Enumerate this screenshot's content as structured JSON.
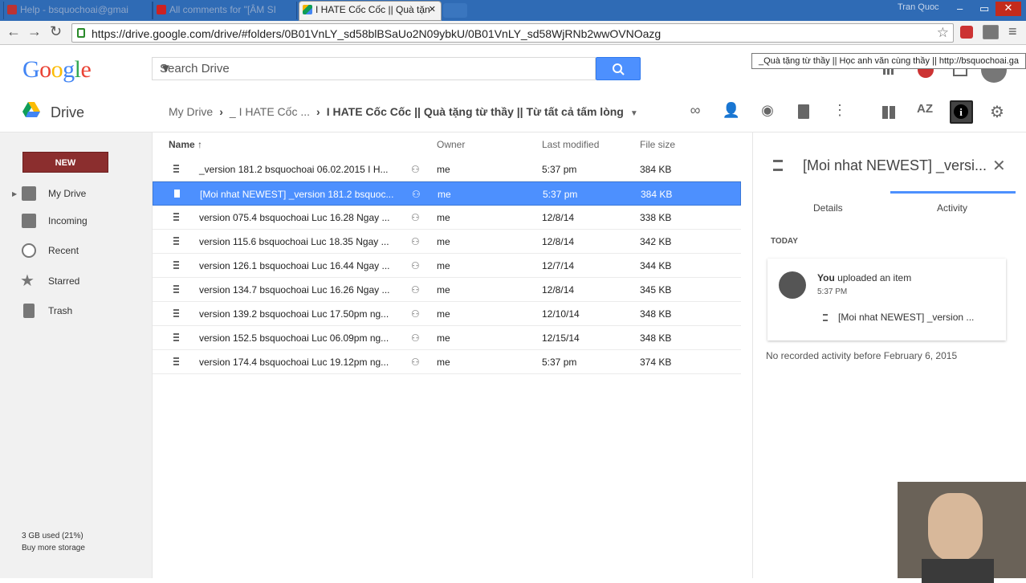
{
  "browser": {
    "tabs": [
      {
        "label": "Help - bsquochoai@gmai",
        "active": false
      },
      {
        "label": "All comments for \"[ÂM SI",
        "active": false
      },
      {
        "label": "I HATE Cốc Cốc || Quà tặn",
        "active": true
      }
    ],
    "window_user": "Tran Quoc",
    "url": "https://drive.google.com/drive/#folders/0B01VnLY_sd58blBSaUo2N09ybkU/0B01VnLY_sd58WjRNb2wwOVNOazg",
    "tooltip": "_Quà tặng từ thầy || Học anh văn cùng thầy || http://bsquochoai.ga"
  },
  "header": {
    "logo": "Google",
    "search_placeholder": "Search Drive"
  },
  "subheader": {
    "app_title": "Drive",
    "breadcrumb": [
      "My Drive",
      "_ I HATE Cốc ...",
      "I HATE Cốc Cốc || Quà tặng từ thầy || Từ tất cả tấm lòng"
    ]
  },
  "sidebar": {
    "new_label": "NEW",
    "items": [
      {
        "label": "My Drive",
        "icon": "my-drive-icon"
      },
      {
        "label": "Incoming",
        "icon": "incoming-icon"
      },
      {
        "label": "Recent",
        "icon": "clock-icon"
      },
      {
        "label": "Starred",
        "icon": "star-icon"
      },
      {
        "label": "Trash",
        "icon": "trash-icon"
      }
    ],
    "storage_used": "3 GB used (21%)",
    "buy_storage": "Buy more storage"
  },
  "file_list": {
    "columns": {
      "name": "Name ↑",
      "owner": "Owner",
      "modified": "Last modified",
      "size": "File size"
    },
    "rows": [
      {
        "name": "_version 181.2 bsquochoai 06.02.2015 I H...",
        "owner": "me",
        "modified": "5:37 pm",
        "size": "384 KB",
        "selected": false
      },
      {
        "name": "[Moi nhat NEWEST] _version 181.2 bsquoc...",
        "owner": "me",
        "modified": "5:37 pm",
        "size": "384 KB",
        "selected": true
      },
      {
        "name": "version 075.4 bsquochoai Luc 16.28 Ngay ...",
        "owner": "me",
        "modified": "12/8/14",
        "size": "338 KB",
        "selected": false
      },
      {
        "name": "version 115.6 bsquochoai Luc 18.35 Ngay ...",
        "owner": "me",
        "modified": "12/8/14",
        "size": "342 KB",
        "selected": false
      },
      {
        "name": "version 126.1 bsquochoai Luc 16.44 Ngay ...",
        "owner": "me",
        "modified": "12/7/14",
        "size": "344 KB",
        "selected": false
      },
      {
        "name": "version 134.7 bsquochoai Luc 16.26 Ngay ...",
        "owner": "me",
        "modified": "12/8/14",
        "size": "345 KB",
        "selected": false
      },
      {
        "name": "version 139.2 bsquochoai Luc 17.50pm ng...",
        "owner": "me",
        "modified": "12/10/14",
        "size": "348 KB",
        "selected": false
      },
      {
        "name": "version 152.5 bsquochoai Luc 06.09pm ng...",
        "owner": "me",
        "modified": "12/15/14",
        "size": "348 KB",
        "selected": false
      },
      {
        "name": "version 174.4 bsquochoai Luc 19.12pm ng...",
        "owner": "me",
        "modified": "5:37 pm",
        "size": "374 KB",
        "selected": false
      }
    ]
  },
  "details_panel": {
    "title": "[Moi nhat NEWEST] _versi...",
    "tabs": [
      "Details",
      "Activity"
    ],
    "active_tab": "Activity",
    "section": "TODAY",
    "activity": {
      "actor": "You",
      "action": "uploaded an item",
      "time": "5:37 PM",
      "file": "[Moi nhat NEWEST] _version ..."
    },
    "no_record": "No recorded activity before February 6, 2015"
  },
  "colors": {
    "accent": "#4d90fe",
    "new_button": "#8b2e2e",
    "titlebar": "#2f6bb5"
  }
}
